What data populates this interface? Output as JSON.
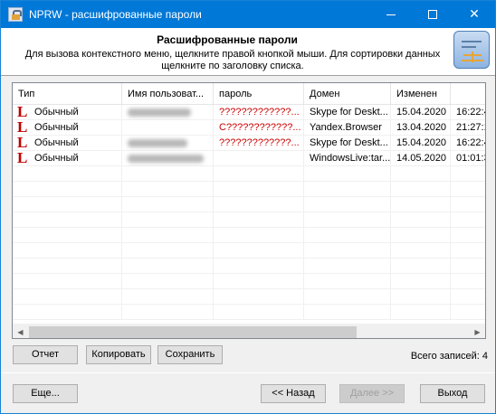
{
  "window": {
    "title": "NPRW - расшифрованные пароли"
  },
  "header": {
    "title": "Расшифрованные пароли",
    "description_line1": "Для вызова контекстного меню, щелкните правой кнопкой мыши. Для сортировки данных",
    "description_line2": "щелкните по заголовку списка."
  },
  "table": {
    "columns": [
      "Тип",
      "Имя пользоват...",
      "пароль",
      "Домен",
      "Изменен",
      ""
    ],
    "rows": [
      {
        "type": "Обычный",
        "password": "?????????????...",
        "domain": "Skype for Deskt...",
        "date": "15.04.2020",
        "time": "16:22:4"
      },
      {
        "type": "Обычный",
        "password": "C????????????...",
        "domain": "Yandex.Browser",
        "date": "13.04.2020",
        "time": "21:27:1"
      },
      {
        "type": "Обычный",
        "password": "?????????????...",
        "domain": "Skype for Deskt...",
        "date": "15.04.2020",
        "time": "16:22:4"
      },
      {
        "type": "Обычный",
        "password": "",
        "domain": "WindowsLive:tar...",
        "date": "14.05.2020",
        "time": "01:01:3"
      }
    ]
  },
  "buttons": {
    "report": "Отчет",
    "copy": "Копировать",
    "save": "Сохранить",
    "more": "Еще...",
    "back": "<< Назад",
    "next": "Далее >>",
    "exit": "Выход"
  },
  "status": {
    "total_records": "Всего записей: 4"
  },
  "colors": {
    "titlebar": "#0078d7",
    "password_text": "#cc0000",
    "type_icon": "#c00000"
  },
  "icons": {
    "row_type": "L"
  }
}
